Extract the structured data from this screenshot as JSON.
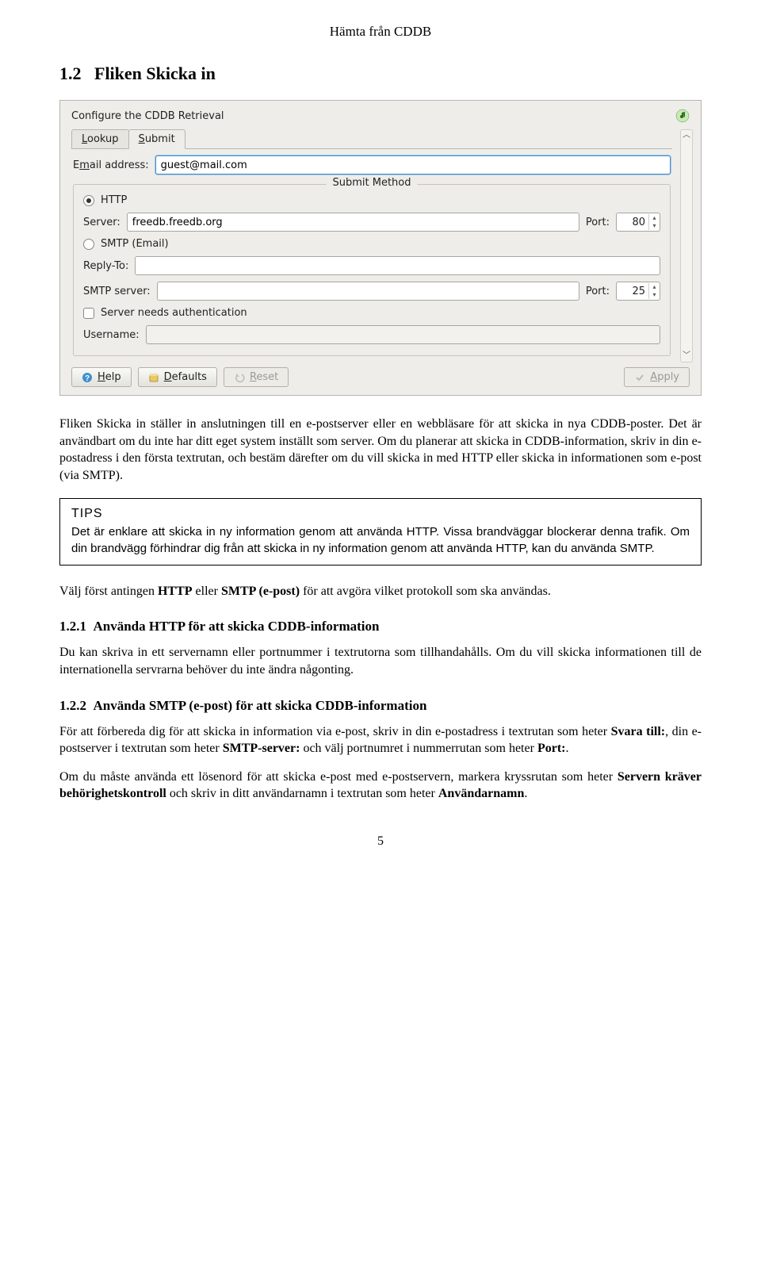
{
  "header": "Hämta från CDDB",
  "section": {
    "number": "1.2",
    "title": "Fliken Skicka in"
  },
  "screenshot": {
    "title": "Configure the CDDB Retrieval",
    "tabs": {
      "lookup": "Lookup",
      "submit": "Submit"
    },
    "email_label_pre": "E",
    "email_label_ul": "m",
    "email_label_post": "ail address:",
    "email_value": "guest@mail.com",
    "submit_method": "Submit Method",
    "http_pre": "H",
    "http_ul": "T",
    "http_post": "TP",
    "server_label": "Server:",
    "server_value": "freedb.freedb.org",
    "port_label": "Port:",
    "http_port": "80",
    "smtp_pre": "SMTP (",
    "smtp_ul": "E",
    "smtp_post": "mail)",
    "reply_to_label": "Reply-To:",
    "smtp_server_label": "SMTP server:",
    "smtp_port": "25",
    "auth_pre": "Server ",
    "auth_ul": "n",
    "auth_post": "eeds authentication",
    "username_label": "Username:",
    "buttons": {
      "help_ul": "H",
      "help_post": "elp",
      "defaults_ul": "D",
      "defaults_post": "efaults",
      "reset_ul": "R",
      "reset_post": "eset",
      "apply_ul": "A",
      "apply_post": "pply"
    }
  },
  "p1": "Fliken Skicka in ställer in anslutningen till en e-postserver eller en webbläsare för att skicka in nya CDDB-poster. Det är användbart om du inte har ditt eget system inställt som server. Om du planerar att skicka in CDDB-information, skriv in din e-postadress i den första textrutan, och bestäm därefter om du vill skicka in med HTTP eller skicka in informationen som e-post (via SMTP).",
  "tips": {
    "title": "TIPS",
    "body": "Det är enklare att skicka in ny information genom att använda HTTP. Vissa brandväggar blockerar denna trafik. Om din brandvägg förhindrar dig från att skicka in ny information genom att använda HTTP, kan du använda SMTP."
  },
  "p2_pre": "Välj först antingen ",
  "p2_b1": "HTTP",
  "p2_mid": " eller ",
  "p2_b2": "SMTP (e-post)",
  "p2_post": " för att avgöra vilket protokoll som ska användas.",
  "sub1": {
    "num": "1.2.1",
    "title": "Använda HTTP för att skicka CDDB-information"
  },
  "p3": "Du kan skriva in ett servernamn eller portnummer i textrutorna som tillhandahålls. Om du vill skicka informationen till de internationella servrarna behöver du inte ändra någonting.",
  "sub2": {
    "num": "1.2.2",
    "title": "Använda SMTP (e-post) för att skicka CDDB-information"
  },
  "p4_a": "För att förbereda dig för att skicka in information via e-post, skriv in din e-postadress i textrutan som heter ",
  "p4_b1": "Svara till:",
  "p4_b": ", din e-postserver i textrutan som heter ",
  "p4_b2": "SMTP-server:",
  "p4_c": " och välj portnumret i nummerrutan som heter ",
  "p4_b3": "Port:",
  "p4_d": ".",
  "p5_a": "Om du måste använda ett lösenord för att skicka e-post med e-postservern, markera kryssrutan som heter ",
  "p5_b1": "Servern kräver behörighetskontroll",
  "p5_b": " och skriv in ditt användarnamn i textrutan som heter ",
  "p5_b2": "Användarnamn",
  "p5_c": ".",
  "page_num": "5"
}
